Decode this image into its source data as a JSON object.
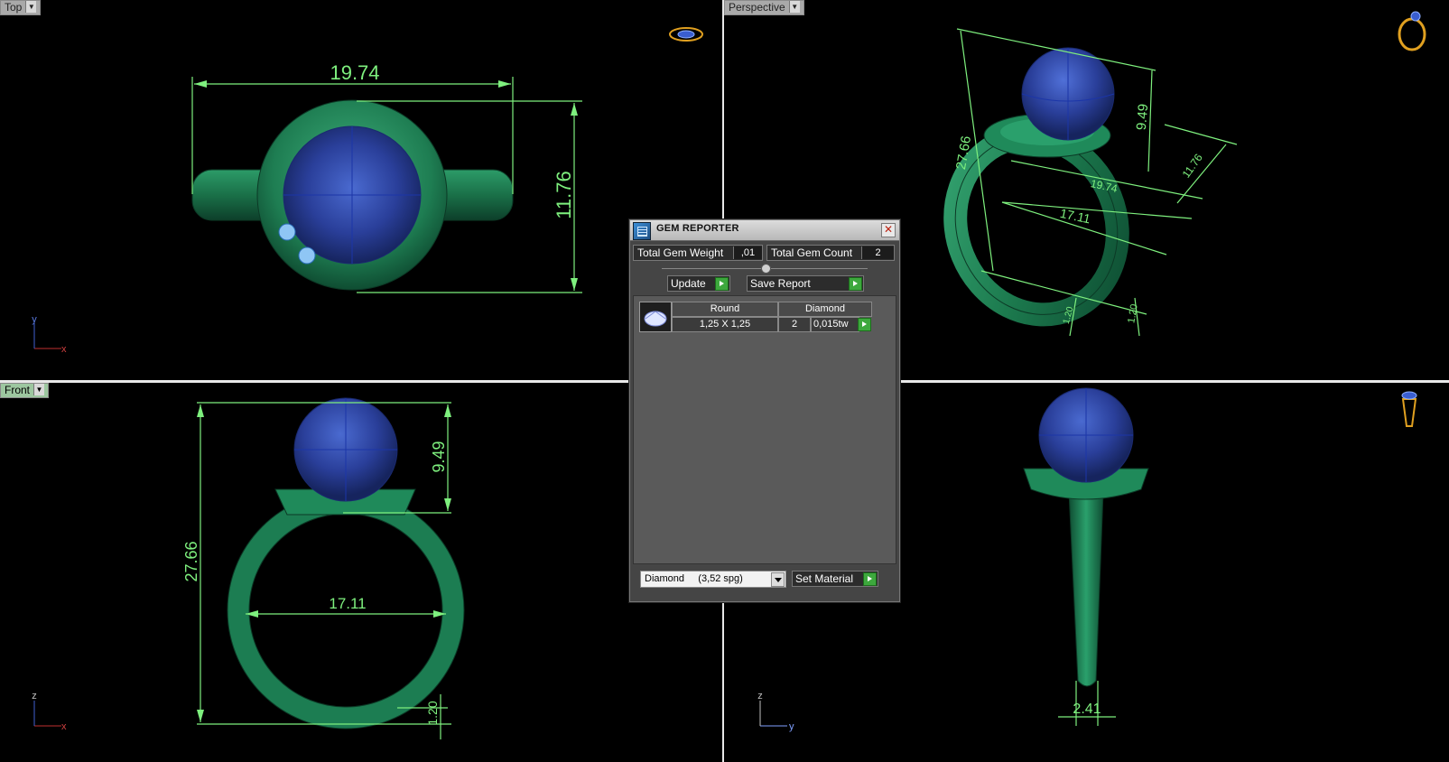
{
  "viewports": {
    "top": {
      "label": "Top",
      "dims": {
        "width": "19.74",
        "depth": "11.76"
      },
      "axes": {
        "v": "y",
        "h": "x"
      }
    },
    "perspective": {
      "label": "Perspective",
      "dims": {
        "height": "27.66",
        "stone": "9.49",
        "head": "11.76",
        "width": "19.74",
        "inner": "17.11",
        "band_a": "1.20",
        "band_b": "1.20"
      }
    },
    "front": {
      "label": "Front",
      "dims": {
        "height": "27.66",
        "stone": "9.49",
        "inner": "17.11",
        "band": "1.20"
      },
      "axes": {
        "v": "z",
        "h": "x"
      }
    },
    "right": {
      "dims": {
        "shank_width": "2.41"
      },
      "axes": {
        "v": "z",
        "h": "y"
      }
    }
  },
  "gem_reporter": {
    "title": "GEM REPORTER",
    "total_weight_label": "Total Gem Weight",
    "total_weight_value": ",01",
    "total_count_label": "Total Gem Count",
    "total_count_value": "2",
    "update_label": "Update",
    "save_label": "Save Report",
    "gems": [
      {
        "cut": "Round",
        "material": "Diamond",
        "size": "1,25 X 1,25",
        "count": "2",
        "weight": "0,015tw"
      }
    ],
    "material_select": "Diamond     (3,52 spg)",
    "set_material_label": "Set Material"
  },
  "colors": {
    "metal": "#1f8a5a",
    "stone": "#2b4aa8",
    "dimension": "#7ef07e",
    "background": "#000000"
  }
}
